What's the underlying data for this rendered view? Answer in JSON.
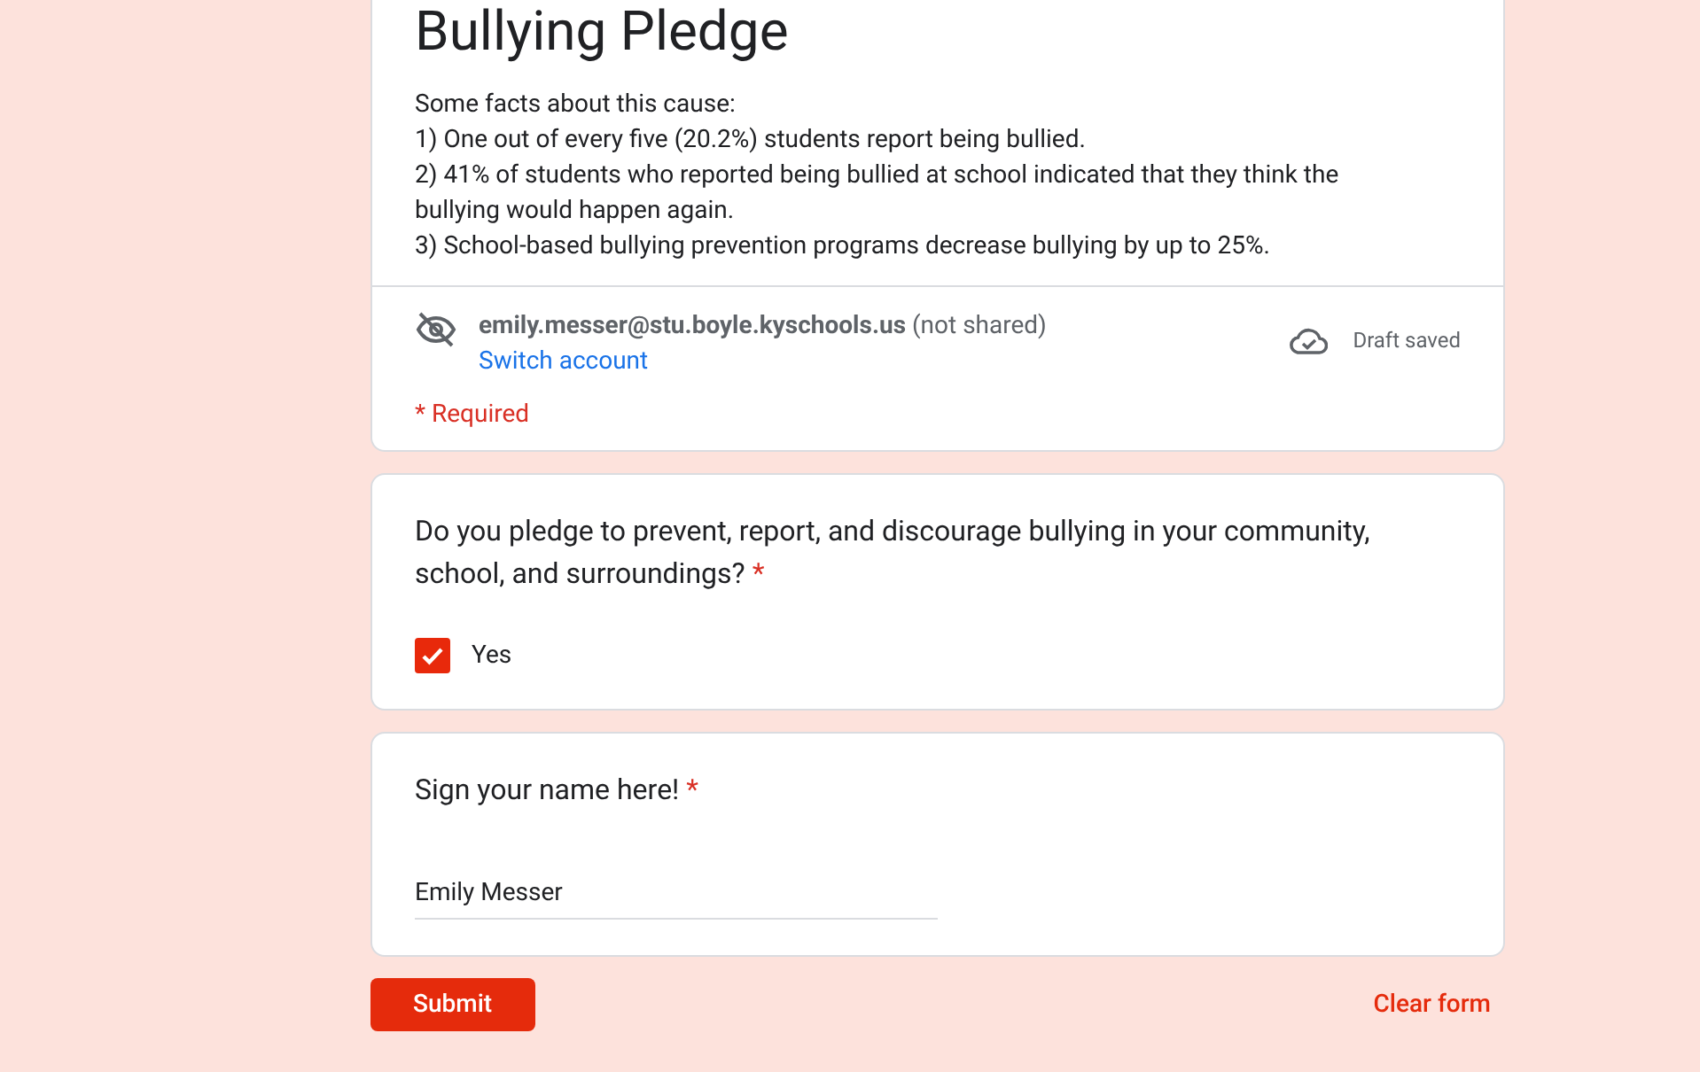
{
  "header": {
    "title": "Bullying Pledge",
    "description": [
      "Some facts about this cause:",
      "1) One out of every five (20.2%) students report being bullied.",
      "2) 41% of students who reported being bullied at school indicated that they think the bullying would happen again.",
      "3) School-based bullying prevention programs decrease bullying by up to 25%."
    ],
    "account": {
      "email": "emily.messer@stu.boyle.kyschools.us",
      "note": "(not shared)",
      "switch_link": "Switch account"
    },
    "save_status": "Draft saved",
    "required_note": "* Required"
  },
  "questions": [
    {
      "kind": "checkbox",
      "title": "Do you pledge to prevent, report, and discourage bullying in your community, school, and surroundings?",
      "required": true,
      "options": [
        {
          "label": "Yes",
          "checked": true
        }
      ]
    },
    {
      "kind": "text",
      "title": "Sign your name here!",
      "required": true,
      "value": "Emily Messer"
    }
  ],
  "required_mark": "*",
  "actions": {
    "submit": "Submit",
    "clear": "Clear form"
  }
}
